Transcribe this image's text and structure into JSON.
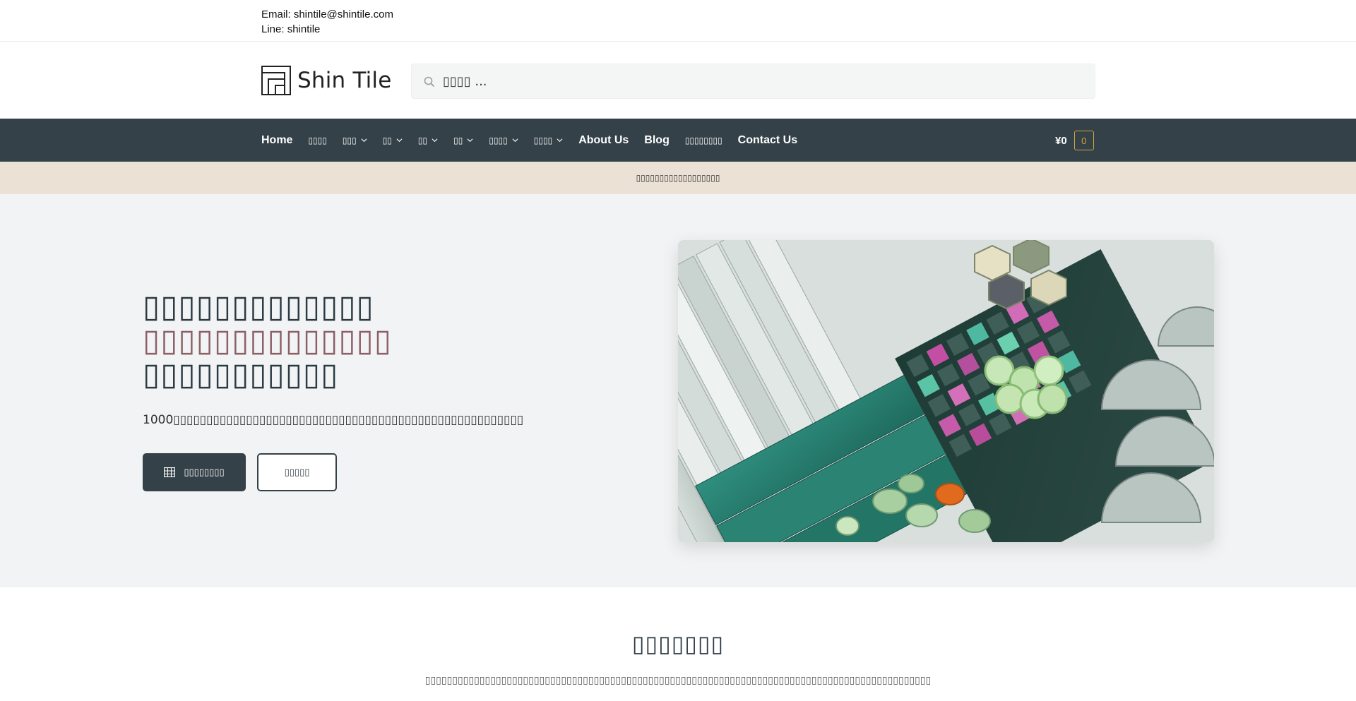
{
  "topbar": {
    "email": "Email: shintile@shintile.com",
    "line": "Line: shintile"
  },
  "header": {
    "logo_text": "Shin Tile",
    "search_placeholder": "▯▯▯▯ ..."
  },
  "nav": {
    "items": [
      {
        "label": "Home"
      },
      {
        "label": "▯▯▯▯"
      },
      {
        "label": "▯▯▯"
      },
      {
        "label": "▯▯"
      },
      {
        "label": "▯▯"
      },
      {
        "label": "▯▯"
      },
      {
        "label": "▯▯▯▯"
      },
      {
        "label": "▯▯▯▯"
      },
      {
        "label": "About Us"
      },
      {
        "label": "Blog"
      },
      {
        "label": "▯▯▯▯▯▯▯▯"
      },
      {
        "label": "Contact Us"
      }
    ],
    "cart_amount": "¥0",
    "cart_count": "0"
  },
  "notice": "▯▯▯▯▯▯▯▯▯▯▯▯▯▯▯▯▯▯",
  "hero": {
    "line1": "▯▯▯▯▯▯▯▯▯▯▯▯▯",
    "line2": "▯▯▯▯▯▯▯▯▯▯▯▯▯▯",
    "line3": "▯▯▯▯▯▯▯▯▯▯▯",
    "subtitle": "1000▯▯▯▯▯▯▯▯▯▯▯▯▯▯▯▯▯▯▯▯▯▯▯▯▯▯▯▯▯▯▯▯▯▯▯▯▯▯▯▯▯▯▯▯▯▯▯▯▯▯▯▯▯▯▯▯▯▯▯▯▯▯▯▯▯▯▯▯▯▯▯▯▯▯▯▯▯▯▯▯▯▯▯▯▯",
    "primary_button": "▯▯▯▯▯▯▯▯",
    "secondary_button": "▯▯▯▯▯"
  },
  "section": {
    "title": "▯▯▯▯▯▯▯",
    "subtitle": "▯▯▯▯▯▯▯▯▯▯▯▯▯▯▯▯▯▯▯▯▯▯▯▯▯▯▯▯▯▯▯▯▯▯▯▯▯▯▯▯▯▯▯▯▯▯▯▯▯▯▯▯▯▯▯▯▯▯▯▯▯▯▯▯▯▯▯▯▯▯▯▯▯▯▯▯▯▯▯▯▯▯▯▯▯▯▯▯▯▯▯▯▯"
  },
  "colors": {
    "nav_bg": "#344148",
    "notice_bg": "#ece1d5",
    "hero_bg": "#f1f3f4",
    "accent_text": "#8c5f66",
    "cart_badge": "#d2a63a"
  }
}
